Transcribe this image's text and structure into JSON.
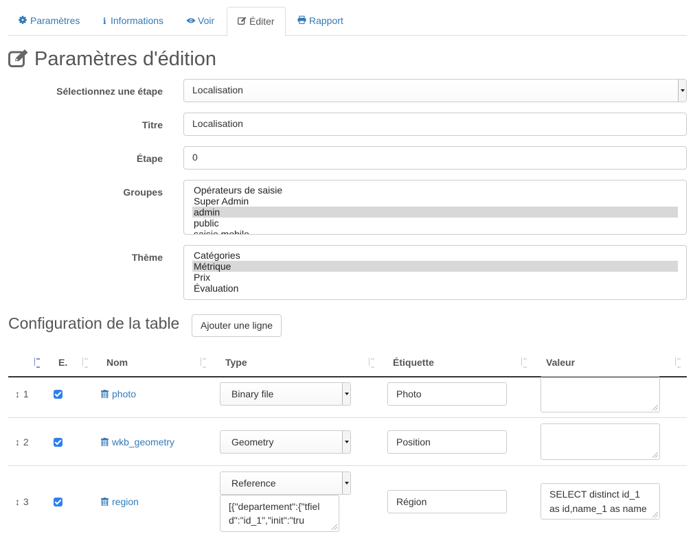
{
  "tabs": [
    {
      "label": "Paramètres",
      "icon": "gear-icon",
      "active": false
    },
    {
      "label": "Informations",
      "icon": "info-icon",
      "active": false
    },
    {
      "label": "Voir",
      "icon": "eye-icon",
      "active": false
    },
    {
      "label": "Éditer",
      "icon": "edit-icon",
      "active": true
    },
    {
      "label": "Rapport",
      "icon": "print-icon",
      "active": false
    }
  ],
  "page_title": "Paramètres d'édition",
  "form": {
    "step_label": "Sélectionnez une étape",
    "step_value": "Localisation",
    "title_label": "Titre",
    "title_value": "Localisation",
    "etape_label": "Étape",
    "etape_value": "0",
    "groups_label": "Groupes",
    "groups": [
      "Opérateurs de saisie",
      "Super Admin",
      "admin",
      "public",
      "saisie mobile"
    ],
    "groups_selected": "admin",
    "theme_label": "Thème",
    "themes": [
      "Catégories",
      "Métrique",
      "Prix",
      "Évaluation"
    ],
    "theme_selected": "Métrique"
  },
  "table_section": {
    "title": "Configuration de la table",
    "add_button": "Ajouter une ligne",
    "headers": [
      "E.",
      "Nom",
      "Type",
      "Étiquette",
      "Valeur"
    ],
    "rows": [
      {
        "order": "1",
        "name": "photo",
        "type": "Binary file",
        "label": "Photo",
        "value": ""
      },
      {
        "order": "2",
        "name": "wkb_geometry",
        "type": "Geometry",
        "label": "Position",
        "value": ""
      },
      {
        "order": "3",
        "name": "region",
        "type": "Reference",
        "type_extra": "[{\"departement\":{\"tfield\":\"id_1\",\"init\":\"tru",
        "label": "Région",
        "value": "SELECT distinct id_1 as id,name_1 as name"
      }
    ]
  },
  "colors": {
    "link": "#337ab7",
    "checkbox": "#2d7ff0",
    "selected_option": "#d8d8d8"
  }
}
